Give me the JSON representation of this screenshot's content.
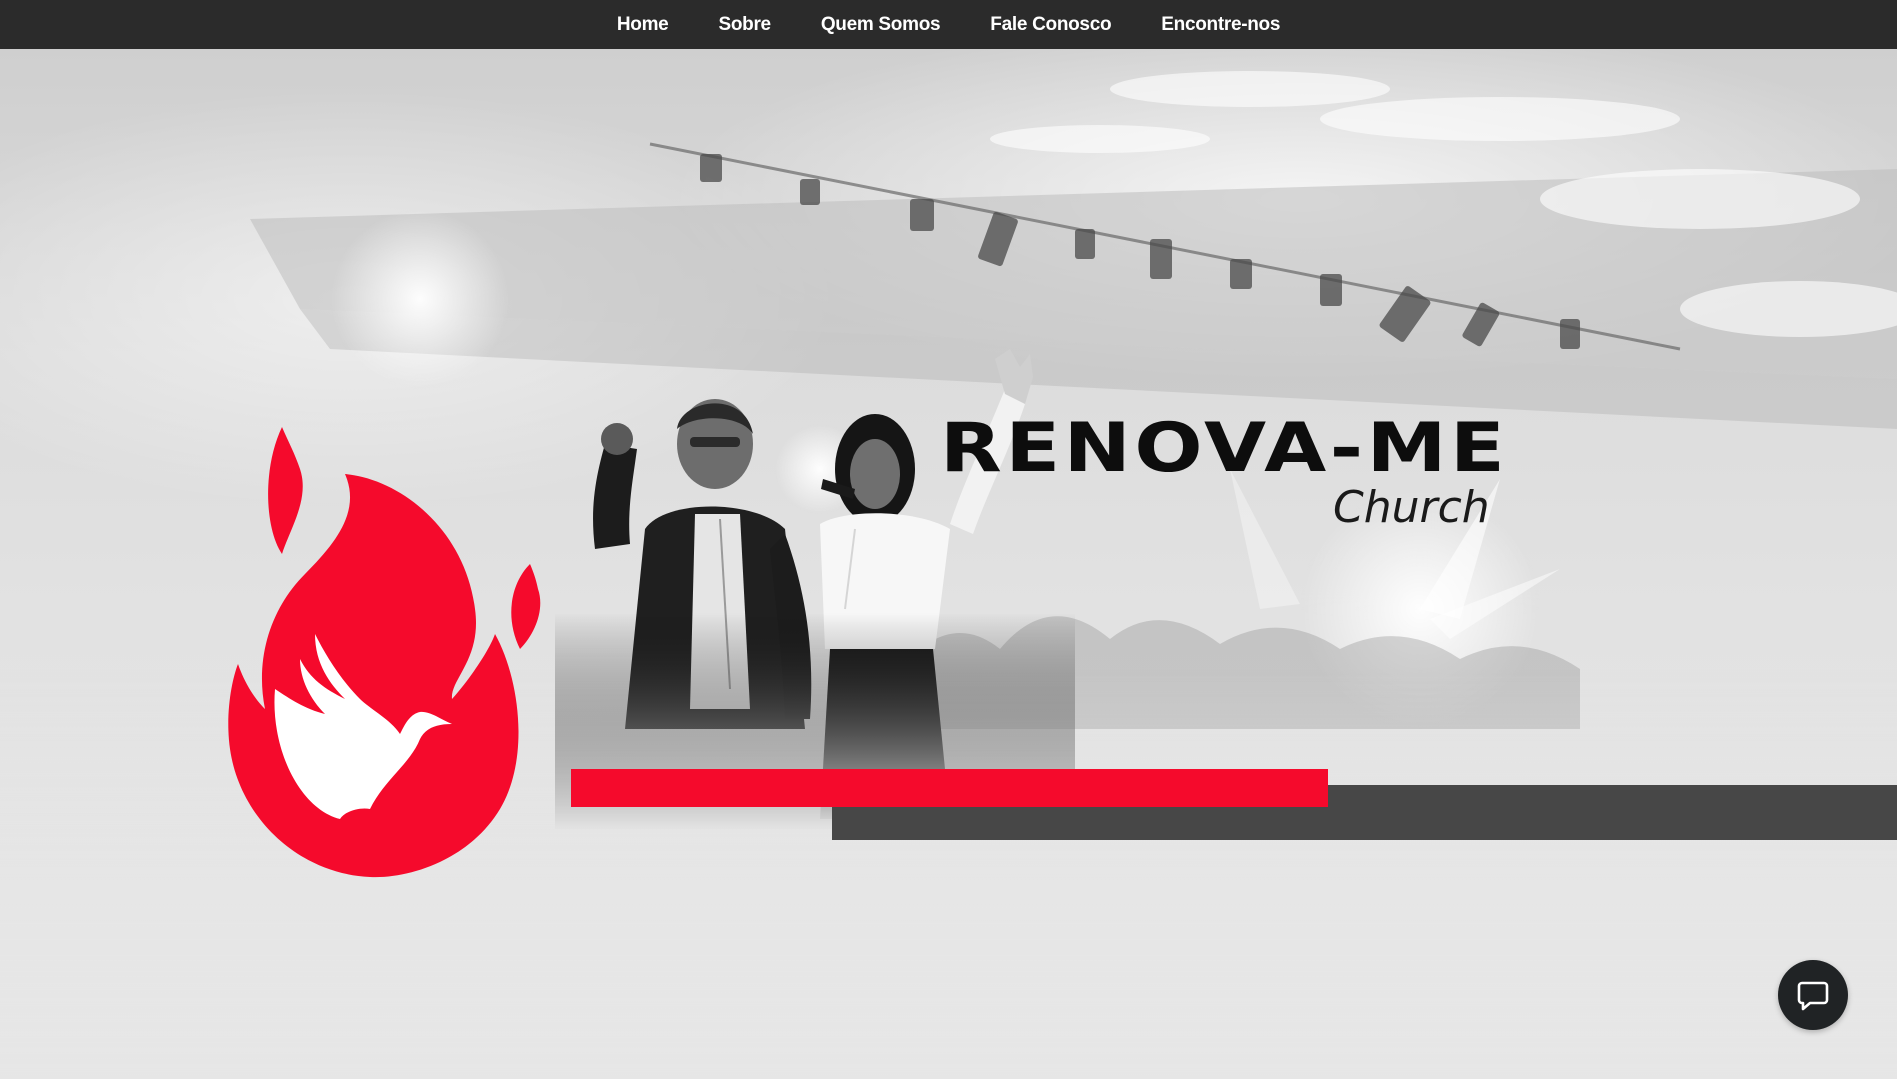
{
  "nav": {
    "items": [
      {
        "label": "Home"
      },
      {
        "label": "Sobre"
      },
      {
        "label": "Quem Somos"
      },
      {
        "label": "Fale Conosco"
      },
      {
        "label": "Encontre-nos"
      }
    ]
  },
  "hero": {
    "title": "RENOVA-ME",
    "subtitle": "Church"
  },
  "colors": {
    "nav_background": "#2b2b2b",
    "brand_red": "#f50a2c",
    "dark_bar": "#474747",
    "chat_button": "#202325"
  },
  "icons": {
    "logo": "flame-dove-icon",
    "chat": "chat-bubble-icon"
  }
}
